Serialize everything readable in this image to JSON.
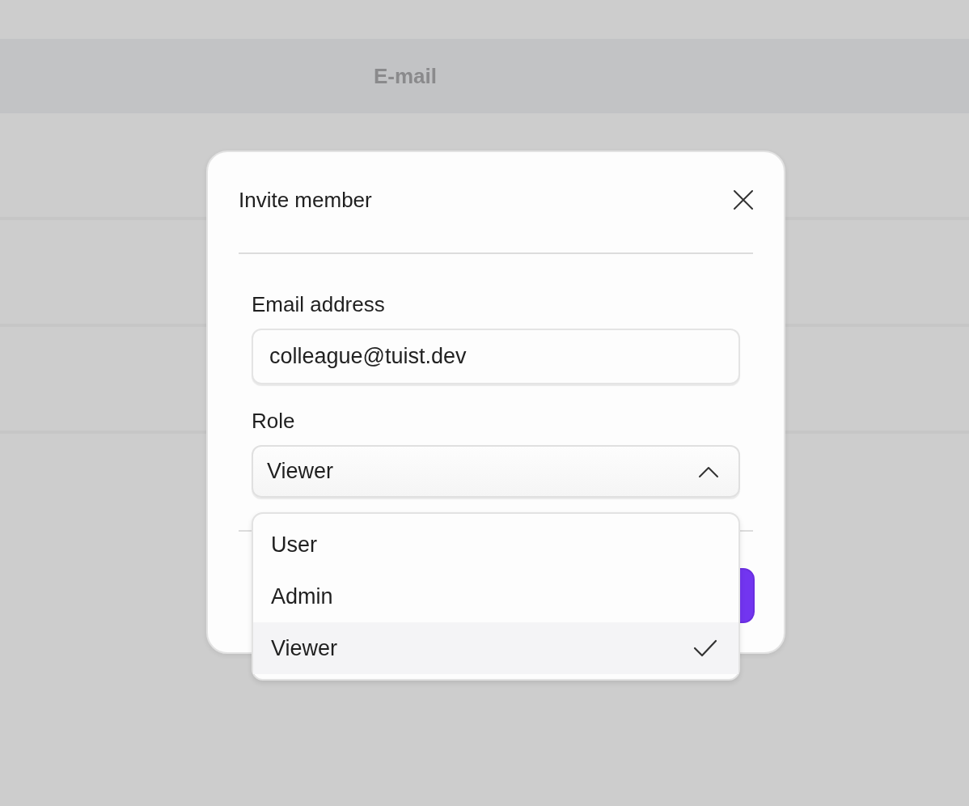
{
  "background_table": {
    "columns": [
      "E-mail"
    ]
  },
  "dialog": {
    "title": "Invite member",
    "fields": [
      {
        "kind": "text",
        "label": "Email address",
        "value": "colleague@tuist.dev"
      },
      {
        "kind": "select",
        "label": "Role",
        "value": "Viewer",
        "expanded": true
      }
    ],
    "buttons": [
      {
        "kind": "primary"
      }
    ]
  },
  "dropdown": {
    "options": [
      {
        "label": "User",
        "selected": false
      },
      {
        "label": "Admin",
        "selected": false
      },
      {
        "label": "Viewer",
        "selected": true
      }
    ]
  }
}
